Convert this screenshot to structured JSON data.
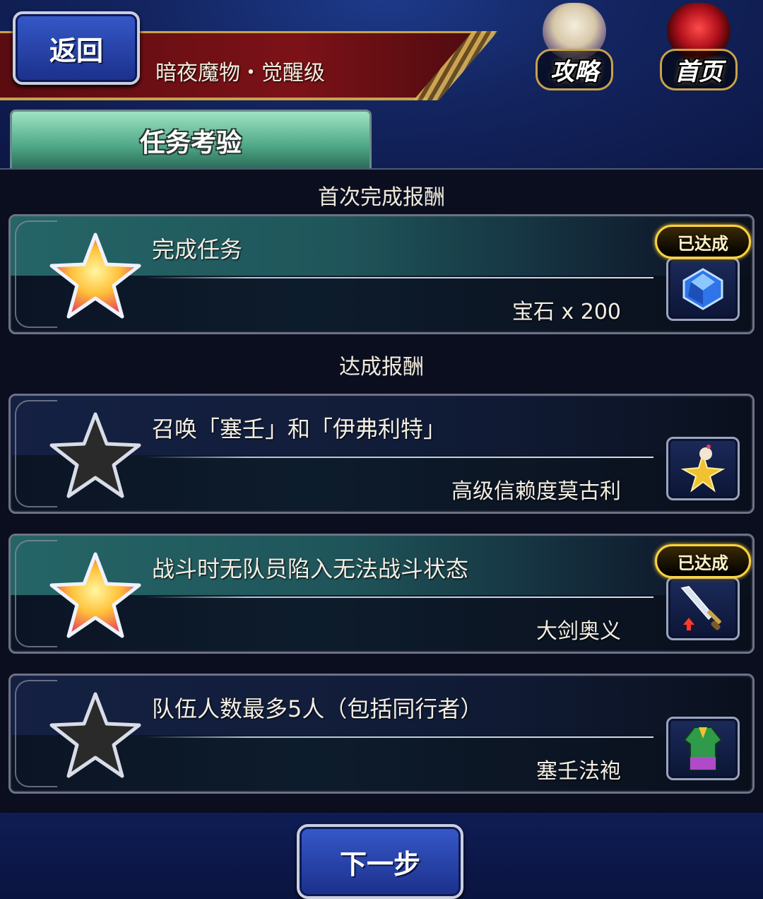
{
  "header": {
    "back_label": "返回",
    "title": "暗夜魔物・觉醒级",
    "guide_label": "攻略",
    "home_label": "首页"
  },
  "tab": {
    "label": "任务考验"
  },
  "sections": {
    "first_clear": "首次完成报酬",
    "achievement": "达成报酬"
  },
  "missions": [
    {
      "task": "完成任务",
      "reward": "宝石 x 200",
      "achieved": true,
      "badge": "已达成",
      "item_icon": "gem-icon"
    },
    {
      "task": "召唤「塞壬」和「伊弗利特」",
      "reward": "高级信赖度莫古利",
      "achieved": false,
      "badge": "",
      "item_icon": "moogle-star-icon"
    },
    {
      "task": "战斗时无队员陷入无法战斗状态",
      "reward": "大剑奥义",
      "achieved": true,
      "badge": "已达成",
      "item_icon": "greatsword-icon"
    },
    {
      "task": "队伍人数最多5人（包括同行者）",
      "reward": "塞壬法袍",
      "achieved": false,
      "badge": "",
      "item_icon": "robe-icon"
    }
  ],
  "footer": {
    "next_label": "下一步"
  },
  "colors": {
    "achieved_star": "#ffb020",
    "unachieved_star": "#2a2a2a",
    "badge_border": "#ffd33a"
  }
}
